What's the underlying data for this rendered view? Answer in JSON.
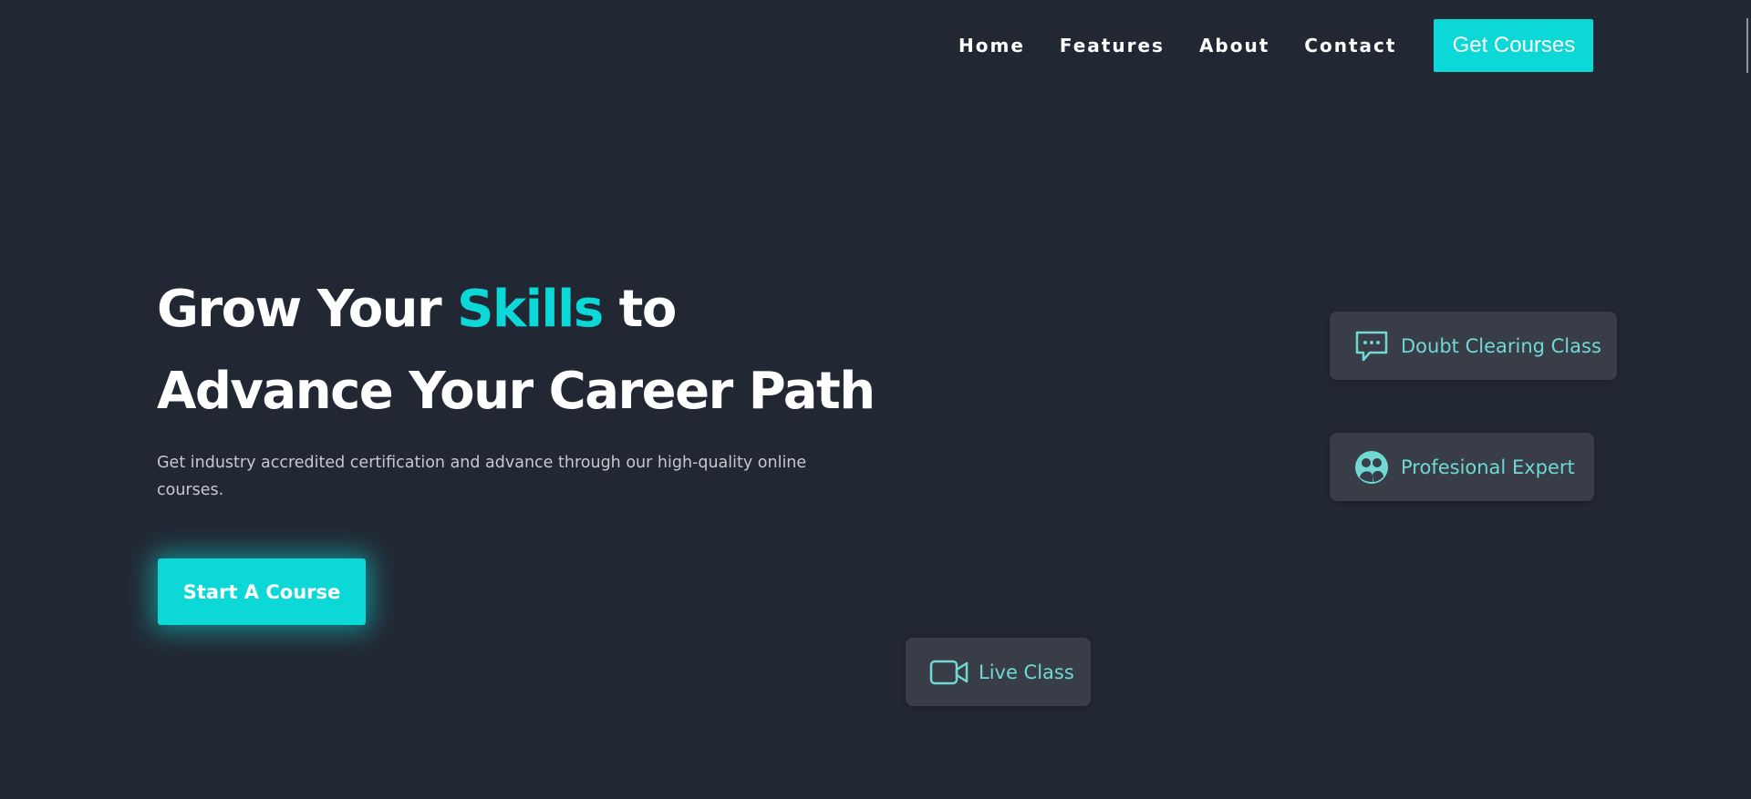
{
  "nav": {
    "links": [
      {
        "label": "Home"
      },
      {
        "label": "Features"
      },
      {
        "label": "About"
      },
      {
        "label": "Contact"
      }
    ],
    "cta_label": "Get Courses"
  },
  "hero": {
    "title_part1": "Grow Your ",
    "title_accent": "Skills",
    "title_part2": " to",
    "title_line2": "Advance Your Career Path",
    "subtitle": "Get industry accredited certification and advance through our high-quality online courses.",
    "cta_label": "Start A Course"
  },
  "cards": {
    "doubt": {
      "label": "Doubt Clearing Class",
      "icon": "chat-bubble-icon"
    },
    "expert": {
      "label": "Profesional Expert",
      "icon": "expert-user-icon"
    },
    "live": {
      "label": "Live Class",
      "icon": "video-camera-icon"
    }
  },
  "colors": {
    "background": "#222833",
    "accent": "#0cd8d8",
    "card_background": "#383d47",
    "card_text": "#71d8d3",
    "subtitle_text": "#c4c9d0"
  }
}
